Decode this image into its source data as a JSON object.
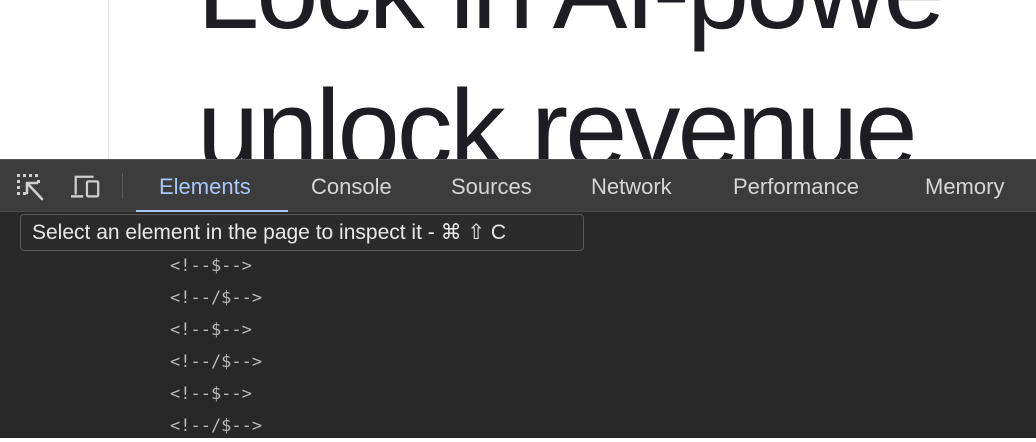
{
  "page": {
    "headline_line1": "Lock in AI-powe",
    "headline_line2": "unlock revenue"
  },
  "devtools": {
    "toolbar": {
      "inspect_icon": "select-element-icon",
      "device_icon": "device-toolbar-icon",
      "tabs": [
        {
          "label": "Elements",
          "active": true
        },
        {
          "label": "Console",
          "active": false
        },
        {
          "label": "Sources",
          "active": false
        },
        {
          "label": "Network",
          "active": false
        },
        {
          "label": "Performance",
          "active": false
        },
        {
          "label": "Memory",
          "active": false
        }
      ],
      "active_color": "#a8c7fa"
    },
    "tooltip": "Select an element in the page to inspect it - ⌘ ⇧ C",
    "code_lines": [
      "<!--$-->",
      "<!--/$-->",
      "<!--$-->",
      "<!--/$-->",
      "<!--$-->",
      "<!--/$-->"
    ]
  }
}
